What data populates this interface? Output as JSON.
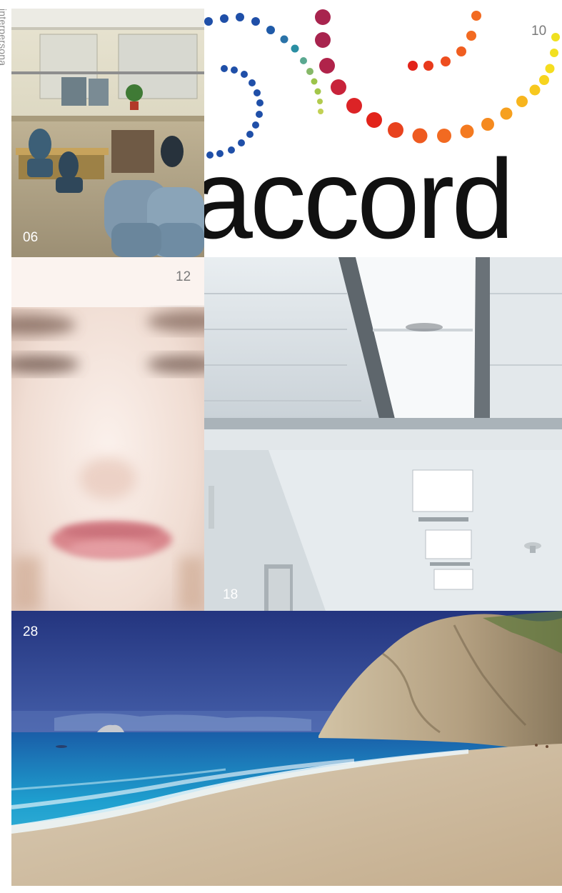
{
  "side_label": "interpersona",
  "panels": {
    "office": {
      "page_number": "06"
    },
    "logo": {
      "page_number": "10",
      "wordmark": "accord"
    },
    "face": {
      "page_number": "12"
    },
    "ceiling": {
      "page_number": "18"
    },
    "beach": {
      "page_number": "28"
    }
  },
  "colors": {
    "background": "#ffffff",
    "dot_blue": "#1f4fa8",
    "dot_teal": "#2b8fa3",
    "dot_green": "#9cc44a",
    "dot_magenta": "#a8244e",
    "dot_red": "#e2231a",
    "dot_orange": "#f26a21",
    "dot_yellow": "#f7c81e",
    "sea": "#1ea6d0",
    "sky": "#2c3f8f"
  }
}
